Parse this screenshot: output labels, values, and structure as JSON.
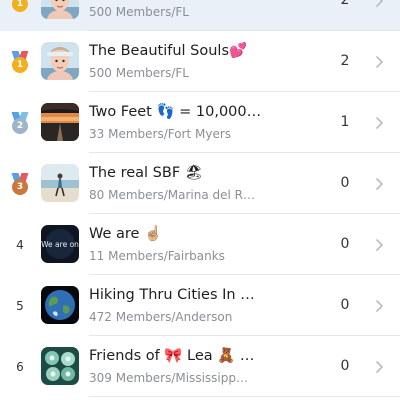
{
  "rows": [
    {
      "rank": "1",
      "title": "",
      "subtitle": "500 Members/FL",
      "count": "2",
      "medal": "gold",
      "highlight": true,
      "avatar": "woman-portrait"
    },
    {
      "rank": "1",
      "title": "The Beautiful Souls💕",
      "subtitle": "500 Members/FL",
      "count": "2",
      "medal": "gold",
      "highlight": false,
      "avatar": "woman-portrait"
    },
    {
      "rank": "2",
      "title": "Two Feet 👣 = 10,000 …",
      "subtitle": "33 Members/Fort Myers",
      "count": "1",
      "medal": "silver",
      "highlight": false,
      "avatar": "sunset-road"
    },
    {
      "rank": "3",
      "title": "The real SBF 🏖",
      "subtitle": "80 Members/Marina del R…",
      "count": "0",
      "medal": "bronze",
      "highlight": false,
      "avatar": "beach-runner"
    },
    {
      "rank": "4",
      "title": "We are ☝🏼",
      "subtitle": "11 Members/Fairbanks",
      "count": "0",
      "medal": "",
      "highlight": false,
      "avatar": "dark-logo"
    },
    {
      "rank": "5",
      "title": "Hiking Thru Cities In H…",
      "subtitle": "472 Members/Anderson",
      "count": "0",
      "medal": "",
      "highlight": false,
      "avatar": "earth-globe"
    },
    {
      "rank": "6",
      "title": "Friends of 🎀 Lea 🧸 A…",
      "subtitle": "309 Members/Mississipp…",
      "count": "0",
      "medal": "",
      "highlight": false,
      "avatar": "flowers"
    }
  ],
  "avatar_text": {
    "dark-logo": "We are on"
  },
  "colors": {
    "gold": "#f2b01e",
    "silver": "#9fb4c8",
    "bronze": "#c9773c",
    "highlight": "#eaf0f8",
    "chevron": "#b7bcc3"
  },
  "icons": {
    "chevron": "chevron-right-icon",
    "medal": "medal-icon"
  }
}
